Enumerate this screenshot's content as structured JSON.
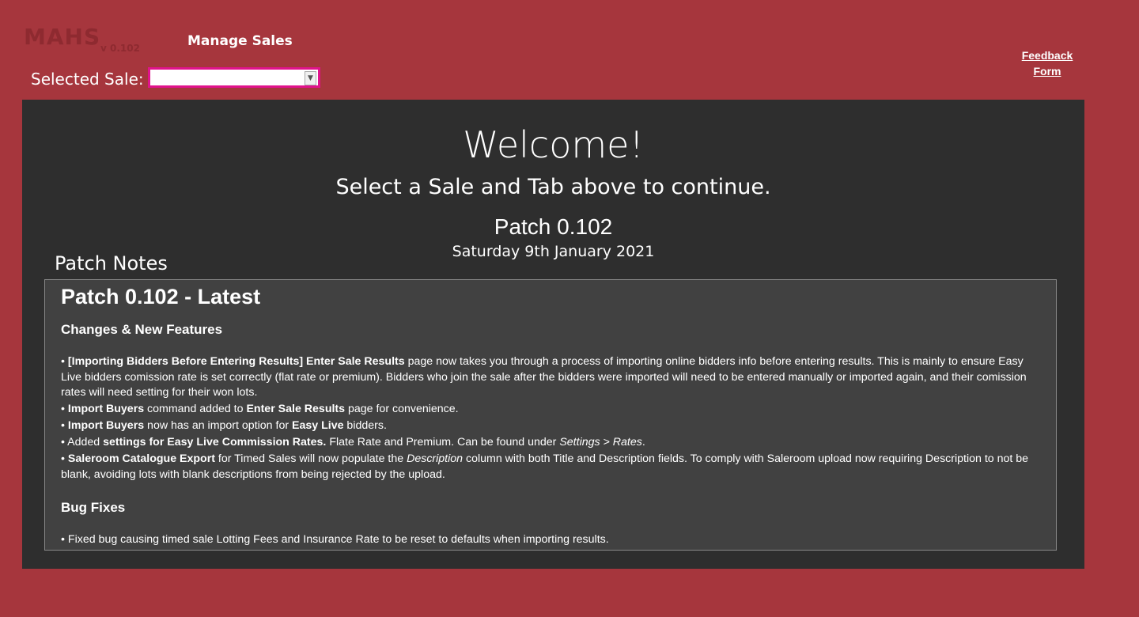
{
  "header": {
    "logo": "MAHS",
    "version": "v 0.102",
    "menu_title": "Manage Sales",
    "sale_label": "Selected Sale:",
    "sale_value": "",
    "feedback_line1": "Feedback",
    "feedback_line2": "Form"
  },
  "welcome": {
    "title": "Welcome!",
    "subtitle": "Select a Sale and Tab above to continue.",
    "patch": "Patch 0.102",
    "date": "Saturday 9th January 2021",
    "notes_label": "Patch Notes"
  },
  "notes": {
    "heading": "Patch 0.102 - Latest",
    "changes_heading": "Changes & New Features",
    "bugs_heading": "Bug Fixes",
    "items": [
      {
        "b1": "[Importing Bidders Before Entering Results] Enter Sale Results",
        "t1": " page now takes you through a process of importing online bidders info before entering results. This is mainly to ensure Easy Live bidders comission rate is set correctly (flat rate or premium). Bidders who join the sale after the bidders were imported will need to be entered manually or imported again, and their comission rates will need setting for their won lots."
      },
      {
        "b1": "Import Buyers",
        "t1": " command added to ",
        "b2": "Enter Sale Results",
        "t2": " page for convenience."
      },
      {
        "b1": "Import Buyers",
        "t1": " now has an import option for ",
        "b2": "Easy Live",
        "t2": " bidders."
      },
      {
        "t0": "Added ",
        "b1": "settings for Easy Live Commission Rates.",
        "t1": " Flate Rate and Premium. Can be found under ",
        "i1": "Settings > Rates",
        "t2": "."
      },
      {
        "b1": "Saleroom Catalogue Export",
        "t1": " for Timed Sales will now populate the ",
        "i1": "Description",
        "t2": " column with both Title and Description fields. To comply with Saleroom upload now requiring Description to not be blank, avoiding lots with blank descriptions from being rejected by the upload."
      }
    ],
    "bug_items": [
      "Fixed bug causing timed sale Lotting Fees and Insurance Rate to be reset to defaults when importing results."
    ],
    "bullet": "•"
  }
}
